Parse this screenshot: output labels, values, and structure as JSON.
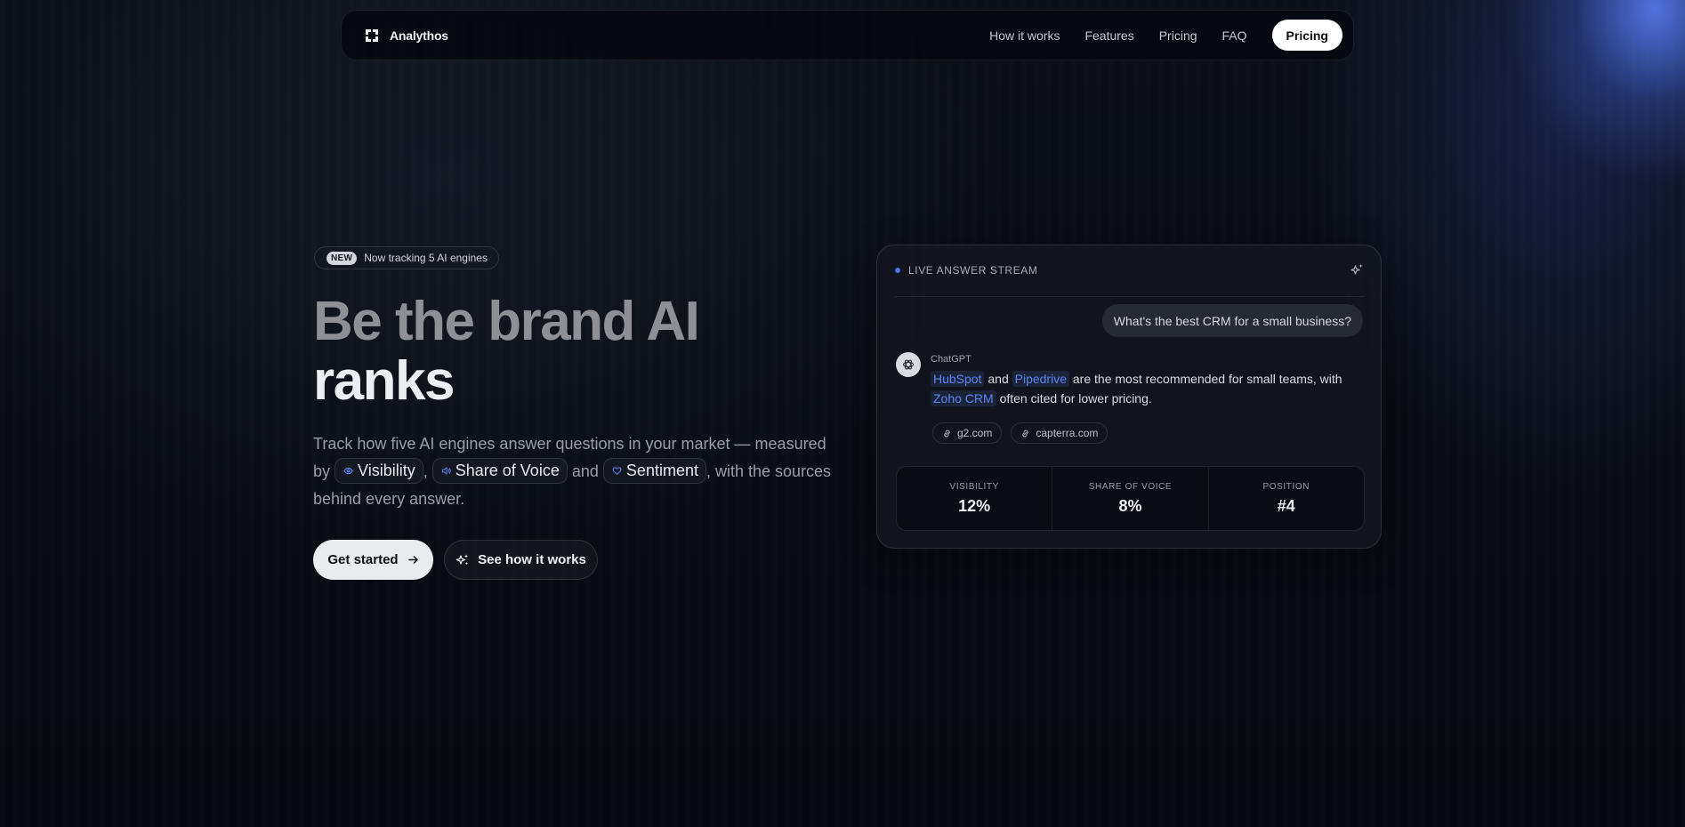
{
  "nav": {
    "brand": "Analythos",
    "links": [
      "How it works",
      "Features",
      "Pricing",
      "FAQ"
    ],
    "cta": "Pricing"
  },
  "hero": {
    "badge_tag": "NEW",
    "badge_text": "Now tracking 5 AI engines",
    "headline_line1": "Be the brand AI",
    "headline_line2": "ranks",
    "sub_before": "Track how five AI engines answer questions in your market — measured by",
    "chip_visibility": "Visibility",
    "sep_comma": ",",
    "chip_share": "Share of Voice",
    "sep_and": "and",
    "chip_sentiment": "Sentiment",
    "sub_after": ", with the sources behind every answer.",
    "primary_button": "Get started",
    "secondary_button": "See how it works"
  },
  "card": {
    "live_label": "LIVE ANSWER STREAM",
    "question": "What's the best CRM for a small business?",
    "engine": "ChatGPT",
    "brand1": "HubSpot",
    "word_and": "and",
    "brand2": "Pipedrive",
    "answer_mid": "are the most recommended for small teams, with",
    "brand3": "Zoho CRM",
    "answer_end": "often cited for lower pricing.",
    "sources": [
      "g2.com",
      "capterra.com"
    ],
    "stats": [
      {
        "label": "VISIBILITY",
        "value": "12%"
      },
      {
        "label": "SHARE OF VOICE",
        "value": "8%"
      },
      {
        "label": "POSITION",
        "value": "#4"
      }
    ]
  },
  "colors": {
    "accent": "#4d72e8",
    "highlight_text": "#5a86f5",
    "background": "#080b12"
  }
}
